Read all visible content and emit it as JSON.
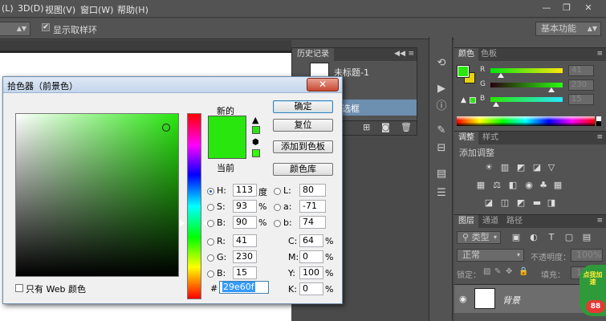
{
  "menubar": {
    "items": [
      "(L)",
      "3D(D)",
      "视图(V)",
      "窗口(W)",
      "帮助(H)"
    ]
  },
  "window_controls": {
    "minimize": "—",
    "restore": "❐",
    "close": "✕"
  },
  "optbar": {
    "show_sampling_ring_label": "显示取样环",
    "workspace": "基本功能"
  },
  "history": {
    "tab": "历史记录",
    "snapshot_label": "未标题-1",
    "state_label": "选框"
  },
  "color_panel": {
    "tab_color": "颜色",
    "tab_swatches": "色板",
    "r_label": "R",
    "g_label": "G",
    "b_label": "B",
    "r_value": "41",
    "g_value": "230",
    "b_value": "15",
    "foreground": "#29e60f",
    "background_swatch": "#e6d20f"
  },
  "adjustments": {
    "tab_adjust": "调整",
    "tab_styles": "样式",
    "add_label": "添加调整"
  },
  "layers": {
    "tab_layers": "图层",
    "tab_channels": "通道",
    "tab_paths": "路径",
    "filter_kind": "类型",
    "blend_mode": "正常",
    "opacity_label": "不透明度：",
    "opacity_value": "100%",
    "lock_label": "锁定：",
    "fill_label": "填充：",
    "fill_value": "100%",
    "layer_name": "背景",
    "badge_text": "点我加速",
    "badge_number": "88"
  },
  "picker": {
    "title": "拾色器（前景色）",
    "new_label": "新的",
    "current_label": "当前",
    "ok": "确定",
    "reset": "复位",
    "add_to_swatches": "添加到色板",
    "color_libraries": "颜色库",
    "web_only_label": "只有 Web 颜色",
    "h_label": "H:",
    "h_value": "113",
    "h_unit": "度",
    "s_label": "S:",
    "s_value": "93",
    "s_unit": "%",
    "b_label": "B:",
    "b_value": "90",
    "b_unit": "%",
    "r_label": "R:",
    "r_value": "41",
    "g_label": "G:",
    "g_value": "230",
    "bl_label": "B:",
    "bl_value": "15",
    "L_label": "L:",
    "L_value": "80",
    "a_label": "a:",
    "a_value": "-71",
    "b2_label": "b:",
    "b2_value": "74",
    "C_label": "C:",
    "C_value": "64",
    "M_label": "M:",
    "M_value": "0",
    "Y_label": "Y:",
    "Y_value": "100",
    "K_label": "K:",
    "K_value": "0",
    "pct": "%",
    "hex_label": "#",
    "hex_value": "29e60f",
    "new_color": "#29e60f",
    "current_color": "#29e60f"
  }
}
